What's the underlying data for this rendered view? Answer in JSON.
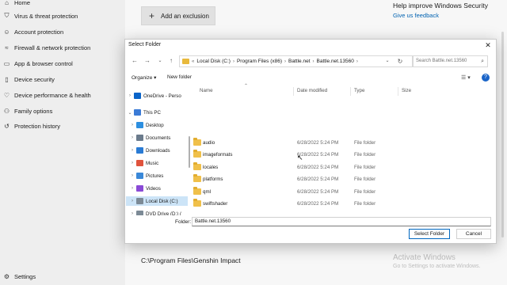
{
  "app": {
    "sidebar": [
      {
        "label": "Home",
        "icon": "home-icon"
      },
      {
        "label": "Virus & threat protection",
        "icon": "shield-icon"
      },
      {
        "label": "Account protection",
        "icon": "person-icon"
      },
      {
        "label": "Firewall & network protection",
        "icon": "wifi-icon"
      },
      {
        "label": "App & browser control",
        "icon": "window-icon"
      },
      {
        "label": "Device security",
        "icon": "laptop-icon"
      },
      {
        "label": "Device performance & health",
        "icon": "heart-icon"
      },
      {
        "label": "Family options",
        "icon": "family-icon"
      },
      {
        "label": "Protection history",
        "icon": "history-icon"
      }
    ],
    "settings_label": "Settings",
    "add_exclusion": "Add an exclusion",
    "help_title": "Help improve Windows Security",
    "help_link": "Give us feedback",
    "exclusion_path": "C:\\Program Files\\Genshin Impact",
    "activate_title": "Activate Windows",
    "activate_sub": "Go to Settings to activate Windows."
  },
  "dialog": {
    "title": "Select Folder",
    "breadcrumb": [
      "Local Disk (C:)",
      "Program Files (x86)",
      "Battle.net",
      "Battle.net.13560"
    ],
    "search_placeholder": "Search Battle.net.13560",
    "organize": "Organize ▾",
    "new_folder": "New folder",
    "columns": {
      "name": "Name",
      "date": "Date modified",
      "type": "Type",
      "size": "Size"
    },
    "tree": [
      {
        "label": "OneDrive - Perso",
        "icon": "cloud-icon",
        "color": "#0a64c9",
        "chev": "›"
      },
      {
        "label": "This PC",
        "icon": "pc-icon",
        "color": "#3b7bd6",
        "chev": "⌄"
      },
      {
        "label": "Desktop",
        "icon": "desktop-icon",
        "color": "#2d8fe0",
        "chev": "›"
      },
      {
        "label": "Documents",
        "icon": "documents-icon",
        "color": "#6b7b8c",
        "chev": "›"
      },
      {
        "label": "Downloads",
        "icon": "downloads-icon",
        "color": "#2a7bd4",
        "chev": "›"
      },
      {
        "label": "Music",
        "icon": "music-icon",
        "color": "#e0533c",
        "chev": "›"
      },
      {
        "label": "Pictures",
        "icon": "pictures-icon",
        "color": "#3a88d8",
        "chev": "›"
      },
      {
        "label": "Videos",
        "icon": "videos-icon",
        "color": "#8a4ad6",
        "chev": "›"
      },
      {
        "label": "Local Disk (C:)",
        "icon": "drive-icon",
        "color": "#7c8a96",
        "chev": "›"
      },
      {
        "label": "DVD Drive (D:) (",
        "icon": "dvd-icon",
        "color": "#7c8a96",
        "chev": "›"
      }
    ],
    "files": [
      {
        "name": "audio",
        "date": "6/28/2022 5:24 PM",
        "type": "File folder"
      },
      {
        "name": "imageformats",
        "date": "6/28/2022 5:24 PM",
        "type": "File folder"
      },
      {
        "name": "locales",
        "date": "6/28/2022 5:24 PM",
        "type": "File folder"
      },
      {
        "name": "platforms",
        "date": "6/28/2022 5:24 PM",
        "type": "File folder"
      },
      {
        "name": "qml",
        "date": "6/28/2022 5:24 PM",
        "type": "File folder"
      },
      {
        "name": "swiftshader",
        "date": "6/28/2022 5:24 PM",
        "type": "File folder"
      }
    ],
    "folder_label": "Folder:",
    "folder_value": "Battle.net.13560",
    "select_button": "Select Folder",
    "cancel_button": "Cancel"
  }
}
